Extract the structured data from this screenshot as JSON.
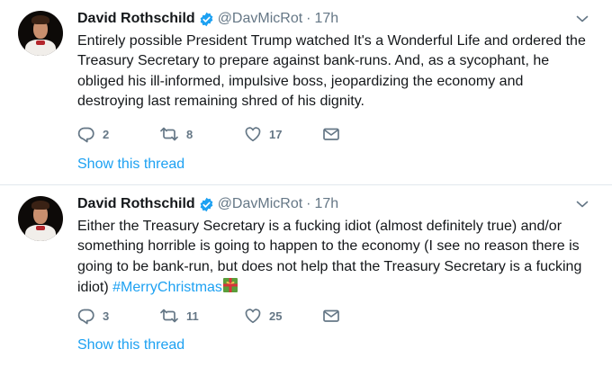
{
  "tweets": [
    {
      "name": "David Rothschild",
      "handle": "@DavMicRot",
      "dot": "·",
      "time": "17h",
      "text": "Entirely possible President Trump watched It's a Wonderful Life and ordered the Treasury Secretary to prepare against bank-runs. And, as a sycophant, he obliged his ill-informed, impulsive boss, jeopardizing the economy and destroying last remaining shred of his dignity.",
      "replies": "2",
      "retweets": "8",
      "likes": "17",
      "show_thread": "Show this thread"
    },
    {
      "name": "David Rothschild",
      "handle": "@DavMicRot",
      "dot": "·",
      "time": "17h",
      "text": "Either the Treasury Secretary is a fucking idiot (almost definitely true) and/or something horrible is going to happen to the economy (I see no reason there is going to be bank-run, but does not help that the Treasury Secretary is a fucking idiot) ",
      "hashtag": "#MerryChristmas",
      "replies": "3",
      "retweets": "11",
      "likes": "25",
      "show_thread": "Show this thread"
    }
  ],
  "colors": {
    "link": "#1da1f2",
    "muted": "#657786",
    "text": "#14171a",
    "divider": "#e1e8ed",
    "verified": "#1da1f2"
  },
  "icons": {
    "verified": "verified-badge-icon",
    "menu": "chevron-down-icon",
    "reply": "reply-icon",
    "retweet": "retweet-icon",
    "like": "heart-icon",
    "message": "envelope-icon",
    "emoji": "gift-emoji-icon"
  }
}
